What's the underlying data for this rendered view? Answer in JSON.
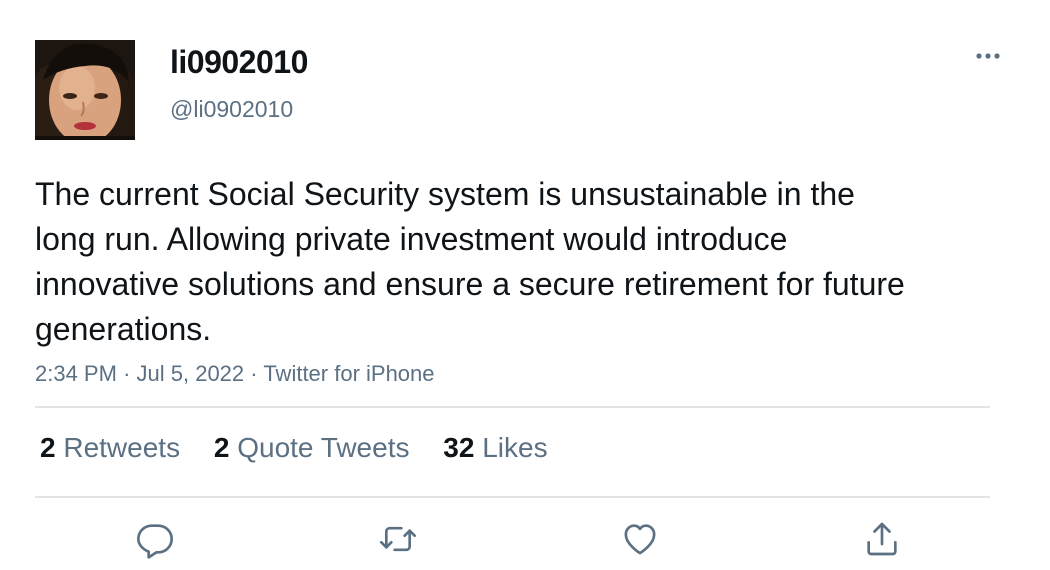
{
  "user": {
    "display_name": "li0902010",
    "handle": "@li0902010"
  },
  "tweet": {
    "text": "The current Social Security system is unsustainable in the long run. Allowing private investment would introduce innovative solutions and ensure a secure retirement for future generations.",
    "time": "2:34 PM",
    "separator": "·",
    "date": "Jul 5, 2022",
    "source": "Twitter for iPhone"
  },
  "stats": {
    "retweets_count": "2",
    "retweets_label": "Retweets",
    "quotes_count": "2",
    "quotes_label": "Quote Tweets",
    "likes_count": "32",
    "likes_label": "Likes"
  },
  "icons": {
    "more": "more-horizontal-icon",
    "reply": "reply-icon",
    "retweet": "retweet-icon",
    "like": "heart-icon",
    "share": "share-icon"
  },
  "colors": {
    "text_primary": "#0f1419",
    "text_secondary": "#5b7083",
    "divider": "#e1e5e8"
  }
}
